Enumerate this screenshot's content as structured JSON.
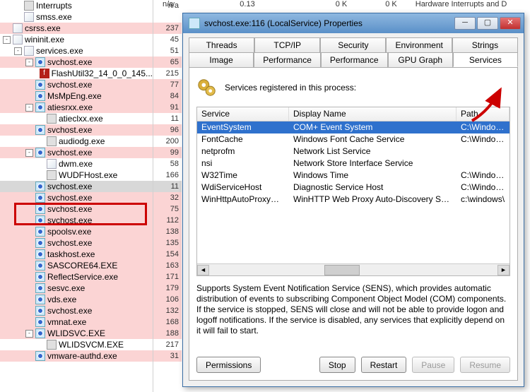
{
  "bg": {
    "cols": [
      "n/a",
      "0.13",
      "0 K",
      "0 K",
      "Hardware Interrupts and D"
    ]
  },
  "tree": [
    {
      "i": 2,
      "exp": null,
      "name": "Interrupts",
      "val": "n/a",
      "pink": false,
      "icon": "proc"
    },
    {
      "i": 2,
      "exp": null,
      "name": "smss.exe",
      "val": "",
      "pink": false,
      "icon": "win"
    },
    {
      "i": 1,
      "exp": null,
      "name": "csrss.exe",
      "val": "237",
      "pink": true,
      "icon": "win"
    },
    {
      "i": 1,
      "exp": "-",
      "name": "wininit.exe",
      "val": "45",
      "pink": false,
      "icon": "win"
    },
    {
      "i": 2,
      "exp": "-",
      "name": "services.exe",
      "val": "51",
      "pink": false,
      "icon": "win"
    },
    {
      "i": 3,
      "exp": "-",
      "name": "svchost.exe",
      "val": "65",
      "pink": true,
      "icon": "svc"
    },
    {
      "i": 4,
      "exp": null,
      "name": "FlashUtil32_14_0_0_145...",
      "val": "215",
      "pink": false,
      "icon": "flash"
    },
    {
      "i": 3,
      "exp": null,
      "name": "svchost.exe",
      "val": "77",
      "pink": true,
      "icon": "svc"
    },
    {
      "i": 3,
      "exp": null,
      "name": "MsMpEng.exe",
      "val": "84",
      "pink": true,
      "icon": "svc"
    },
    {
      "i": 3,
      "exp": "-",
      "name": "atiesrxx.exe",
      "val": "91",
      "pink": true,
      "icon": "svc"
    },
    {
      "i": 4,
      "exp": null,
      "name": "atieclxx.exe",
      "val": "11",
      "pink": false,
      "icon": "proc"
    },
    {
      "i": 3,
      "exp": null,
      "name": "svchost.exe",
      "val": "96",
      "pink": true,
      "icon": "svc"
    },
    {
      "i": 4,
      "exp": null,
      "name": "audiodg.exe",
      "val": "200",
      "pink": false,
      "icon": "proc"
    },
    {
      "i": 3,
      "exp": "-",
      "name": "svchost.exe",
      "val": "99",
      "pink": true,
      "icon": "svc"
    },
    {
      "i": 4,
      "exp": null,
      "name": "dwm.exe",
      "val": "58",
      "pink": false,
      "icon": "win"
    },
    {
      "i": 4,
      "exp": null,
      "name": "WUDFHost.exe",
      "val": "166",
      "pink": false,
      "icon": "proc"
    },
    {
      "i": 3,
      "exp": null,
      "name": "svchost.exe",
      "val": "11",
      "pink": true,
      "icon": "svc",
      "sel": true
    },
    {
      "i": 3,
      "exp": null,
      "name": "svchost.exe",
      "val": "32",
      "pink": true,
      "icon": "svc"
    },
    {
      "i": 3,
      "exp": null,
      "name": "svchost.exe",
      "val": "75",
      "pink": true,
      "icon": "svc"
    },
    {
      "i": 3,
      "exp": null,
      "name": "svchost.exe",
      "val": "112",
      "pink": true,
      "icon": "svc"
    },
    {
      "i": 3,
      "exp": null,
      "name": "spoolsv.exe",
      "val": "138",
      "pink": true,
      "icon": "svc"
    },
    {
      "i": 3,
      "exp": null,
      "name": "svchost.exe",
      "val": "135",
      "pink": true,
      "icon": "svc"
    },
    {
      "i": 3,
      "exp": null,
      "name": "taskhost.exe",
      "val": "154",
      "pink": true,
      "icon": "svc"
    },
    {
      "i": 3,
      "exp": null,
      "name": "SASCORE64.EXE",
      "val": "163",
      "pink": true,
      "icon": "svc"
    },
    {
      "i": 3,
      "exp": null,
      "name": "ReflectService.exe",
      "val": "171",
      "pink": true,
      "icon": "svc"
    },
    {
      "i": 3,
      "exp": null,
      "name": "sesvc.exe",
      "val": "179",
      "pink": true,
      "icon": "svc"
    },
    {
      "i": 3,
      "exp": null,
      "name": "vds.exe",
      "val": "106",
      "pink": true,
      "icon": "svc"
    },
    {
      "i": 3,
      "exp": null,
      "name": "svchost.exe",
      "val": "132",
      "pink": true,
      "icon": "svc"
    },
    {
      "i": 3,
      "exp": null,
      "name": "vmnat.exe",
      "val": "168",
      "pink": true,
      "icon": "svc"
    },
    {
      "i": 3,
      "exp": "-",
      "name": "WLIDSVC.EXE",
      "val": "188",
      "pink": true,
      "icon": "svc"
    },
    {
      "i": 4,
      "exp": null,
      "name": "WLIDSVCM.EXE",
      "val": "217",
      "pink": false,
      "icon": "proc"
    },
    {
      "i": 3,
      "exp": null,
      "name": "vmware-authd.exe",
      "val": "31",
      "pink": true,
      "icon": "svc"
    }
  ],
  "dialog": {
    "title": "svchost.exe:116 (LocalService) Properties",
    "tabs_row1": [
      "Threads",
      "TCP/IP",
      "Security",
      "Environment",
      "Strings"
    ],
    "tabs_row2": [
      "Image",
      "Performance",
      "Performance Graph",
      "GPU Graph",
      "Services"
    ],
    "active_tab": "Services",
    "header": "Services registered in this process:",
    "cols": {
      "svc": "Service",
      "disp": "Display Name",
      "path": "Path"
    },
    "rows": [
      {
        "svc": "EventSystem",
        "disp": "COM+ Event System",
        "path": "C:\\Windows",
        "sel": true
      },
      {
        "svc": "FontCache",
        "disp": "Windows Font Cache Service",
        "path": "C:\\Windows"
      },
      {
        "svc": "netprofm",
        "disp": "Network List Service",
        "path": ""
      },
      {
        "svc": "nsi",
        "disp": "Network Store Interface Service",
        "path": ""
      },
      {
        "svc": "W32Time",
        "disp": "Windows Time",
        "path": "C:\\Windows"
      },
      {
        "svc": "WdiServiceHost",
        "disp": "Diagnostic Service Host",
        "path": "C:\\Windows"
      },
      {
        "svc": "WinHttpAutoProxySvc",
        "disp": "WinHTTP Web Proxy Auto-Discovery Service",
        "path": "c:\\windows\\"
      }
    ],
    "desc": "Supports System Event Notification Service (SENS), which provides automatic distribution of events to subscribing Component Object Model (COM) components. If the service is stopped, SENS will close and will not be able to provide logon and logoff notifications. If the service is disabled, any services that explicitly depend on it will fail to start.",
    "btns": {
      "perm": "Permissions",
      "stop": "Stop",
      "restart": "Restart",
      "pause": "Pause",
      "resume": "Resume"
    }
  }
}
